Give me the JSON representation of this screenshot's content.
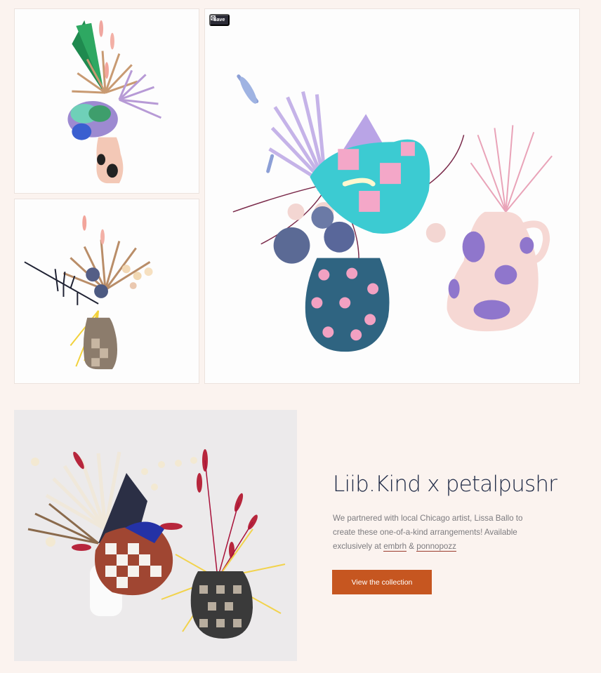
{
  "gallery": {
    "save_label": "Save",
    "images": [
      {
        "alt": "",
        "icon": "dried-flower-arrangement-pastel-vase"
      },
      {
        "alt": "",
        "icon": "dried-flower-arrangement-checkered-vase"
      },
      {
        "alt": "",
        "icon": "two-painted-vases-with-dried-flowers"
      }
    ]
  },
  "feature": {
    "title": "Liib.Kind x petalpushr",
    "description_text": "We partnered with local Chicago artist, Lissa Ballo to create these one-of-a-kind arrangements! Available exclusively at",
    "link1": "embrh",
    "separator": " & ",
    "link2": "ponnopozz",
    "cta_label": "View the collection",
    "photo_icon": "dried-flower-arrangement-checkered-vases"
  },
  "colors": {
    "page_background": "#fbf3ef",
    "title_color": "#1f2a46",
    "cta_background": "#c65620",
    "link_underline": "#9c3b2e"
  }
}
